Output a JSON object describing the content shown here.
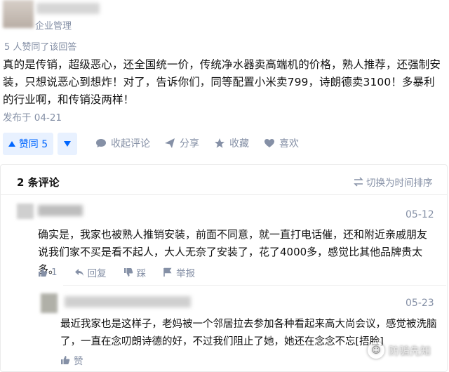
{
  "author": {
    "title": "企业管理"
  },
  "answer": {
    "upvoters_note": "5 人赞同了该回答",
    "text": "真的是传销，超级恶心，还全国统一价，传统净水器卖高端机的价格，熟人推荐，还强制安装，只想说恶心到想炸！对了，告诉你们，同等配置小米卖799，诗朗德卖3100！多暴利的行业啊，和传销没两样！",
    "published": "发布于 04-21"
  },
  "actions": {
    "vote_label": "赞同 5",
    "collapse_comments": "收起评论",
    "share": "分享",
    "favorite": "收藏",
    "like": "喜欢"
  },
  "comments_panel": {
    "count_label": "2 条评论",
    "sort_label": "切换为时间排序",
    "comments": [
      {
        "date": "05-12",
        "text": "确实是，我家也被熟人推销安装，前面不同意，就一直打电话催，还和附近亲戚朋友说我们家不买是看不起人，大人无奈了安装了，花了4000多，感觉比其他品牌贵太多。",
        "likes": "1",
        "reply": "回复",
        "dislike": "踩",
        "report": "举报"
      },
      {
        "date": "05-23",
        "text": "最近我家也是这样子，老妈被一个邻居拉去参加各种看起来高大尚会议，感觉被洗脑了，一直在念叨朗诗德的好，不过我们阻止了她，她还在念念不忘[捂脸]",
        "like": "赞"
      }
    ]
  },
  "watermark": {
    "text": "防骗先知"
  },
  "colors": {
    "accent": "#0066ff",
    "accent_bg": "#e8f1ff",
    "muted": "#8590a6"
  }
}
